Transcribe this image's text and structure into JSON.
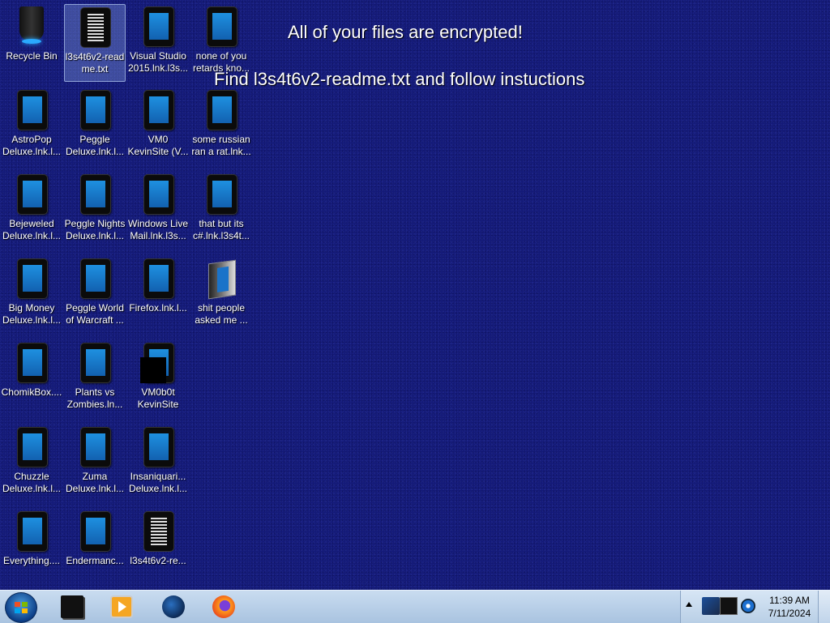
{
  "ransom_message": {
    "line1": "All of your files are encrypted!",
    "line2": "Find l3s4t6v2-readme.txt and follow instuctions"
  },
  "desktop_icons": [
    {
      "line1": "Recycle Bin",
      "line2": "",
      "icon": "recycle-bin-icon"
    },
    {
      "line1": "l3s4t6v2-read",
      "line2": "me.txt",
      "icon": "text-document-icon",
      "selected": true
    },
    {
      "line1": "Visual Studio",
      "line2": "2015.lnk.l3s...",
      "icon": "shortcut-icon"
    },
    {
      "line1": "none of you",
      "line2": "retards kno...",
      "icon": "shortcut-icon"
    },
    {
      "line1": "AstroPop",
      "line2": "Deluxe.lnk.l...",
      "icon": "shortcut-icon"
    },
    {
      "line1": "Peggle",
      "line2": "Deluxe.lnk.l...",
      "icon": "shortcut-icon"
    },
    {
      "line1": "VM0",
      "line2": "KevinSite (V...",
      "icon": "shortcut-icon"
    },
    {
      "line1": "some russian",
      "line2": "ran a rat.lnk...",
      "icon": "shortcut-icon"
    },
    {
      "line1": "Bejeweled",
      "line2": "Deluxe.lnk.l...",
      "icon": "shortcut-icon"
    },
    {
      "line1": "Peggle Nights",
      "line2": "Deluxe.lnk.l...",
      "icon": "shortcut-icon"
    },
    {
      "line1": "Windows Live",
      "line2": "Mail.lnk.l3s...",
      "icon": "shortcut-icon"
    },
    {
      "line1": "that but its",
      "line2": "c#.lnk.l3s4t...",
      "icon": "shortcut-icon"
    },
    {
      "line1": "Big Money",
      "line2": "Deluxe.lnk.l...",
      "icon": "shortcut-icon"
    },
    {
      "line1": "Peggle World",
      "line2": "of Warcraft ...",
      "icon": "shortcut-icon"
    },
    {
      "line1": "Firefox.lnk.l...",
      "line2": "",
      "icon": "shortcut-icon"
    },
    {
      "line1": "shit people",
      "line2": "asked me ...",
      "icon": "folder-icon"
    },
    {
      "line1": "ChomikBox....",
      "line2": "",
      "icon": "shortcut-icon"
    },
    {
      "line1": "Plants vs",
      "line2": "Zombies.ln...",
      "icon": "shortcut-icon"
    },
    {
      "line1": "VM0b0t",
      "line2": "KevinSite",
      "icon": "shortcut-icon"
    },
    {
      "line1": "Chuzzle",
      "line2": "Deluxe.lnk.l...",
      "icon": "shortcut-icon"
    },
    {
      "line1": "Zuma",
      "line2": "Deluxe.lnk.l...",
      "icon": "shortcut-icon"
    },
    {
      "line1": "Insaniquari...",
      "line2": "Deluxe.lnk.l...",
      "icon": "shortcut-icon"
    },
    {
      "line1": "Everything....",
      "line2": "",
      "icon": "shortcut-icon"
    },
    {
      "line1": "Endermanc...",
      "line2": "",
      "icon": "shortcut-icon"
    },
    {
      "line1": "l3s4t6v2-re...",
      "line2": "",
      "icon": "text-document-icon"
    }
  ],
  "taskbar": {
    "pinned": [
      "windows-explorer-icon",
      "media-player-icon",
      "globe-icon",
      "firefox-icon"
    ],
    "clock": {
      "time": "11:39 AM",
      "date": "7/11/2024"
    }
  },
  "colors": {
    "desktop_background": "#141a78",
    "taskbar": "#b5cde6"
  }
}
